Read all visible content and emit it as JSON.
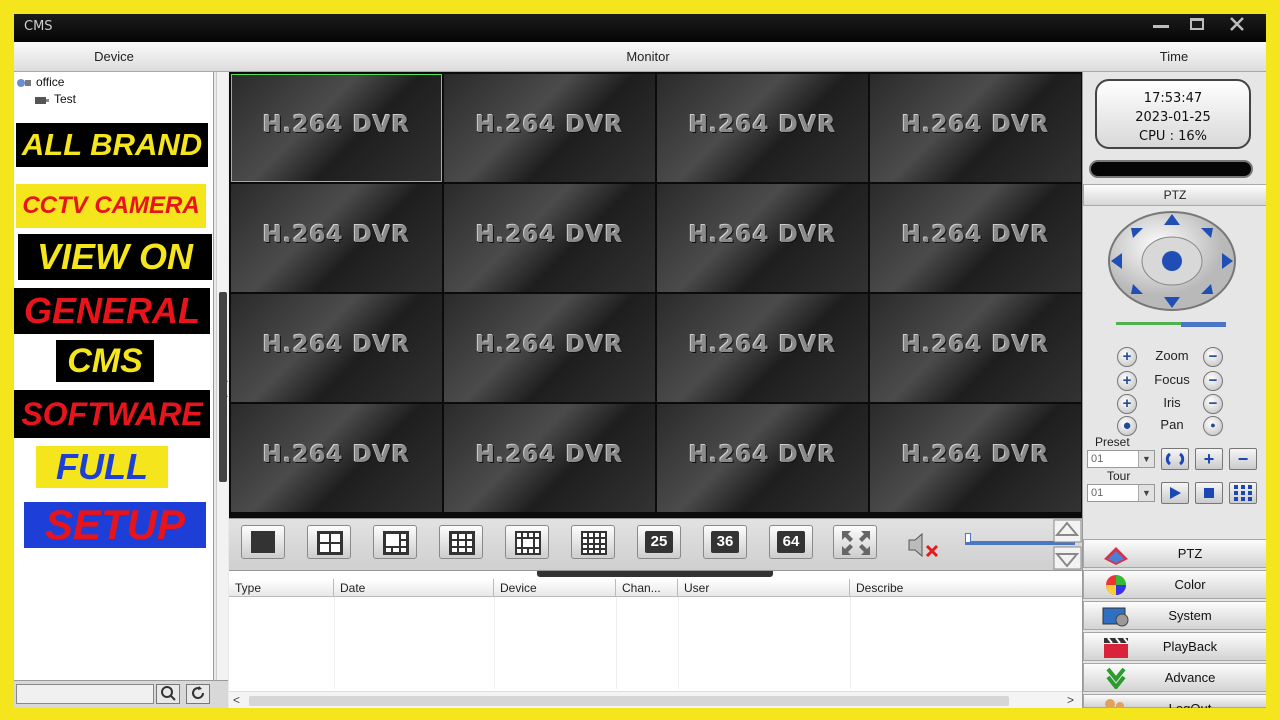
{
  "window": {
    "title": "CMS"
  },
  "columns": {
    "device": "Device",
    "monitor": "Monitor",
    "time": "Time"
  },
  "tree": {
    "root": "office",
    "child": "Test"
  },
  "banners": [
    {
      "text": "ALL BRAND",
      "color": "#f5e51c",
      "bg": "#000000"
    },
    {
      "text": "CCTV CAMERA",
      "color": "#e8141b",
      "bg": "#f5e51c"
    },
    {
      "text": "VIEW ON",
      "color": "#f5e51c",
      "bg": "#000000"
    },
    {
      "text": "GENERAL",
      "color": "#e8141b",
      "bg": "#000000"
    },
    {
      "text": "CMS",
      "color": "#f5e51c",
      "bg": "#000000"
    },
    {
      "text": "SOFTWARE",
      "color": "#e8141b",
      "bg": "#000000"
    },
    {
      "text": "FULL",
      "color": "#1d3fd8",
      "bg": "#f5e51c"
    },
    {
      "text": "SETUP",
      "color": "#e8141b",
      "bg": "#1d3fd8"
    }
  ],
  "grid": {
    "cell_label": "H.264 DVR",
    "rows": 4,
    "cols": 4,
    "selected": 0
  },
  "layouts": [
    "1",
    "4",
    "6",
    "9",
    "13",
    "16",
    "25",
    "36",
    "64"
  ],
  "layout_numbers": {
    "n25": "25",
    "n36": "36",
    "n64": "64"
  },
  "log": {
    "headers": [
      "Type",
      "Date",
      "Device",
      "Chan...",
      "User",
      "Describe"
    ]
  },
  "clock": {
    "time": "17:53:47",
    "date": "2023-01-25",
    "cpu": "CPU : 16%"
  },
  "ptz": {
    "header": "PTZ",
    "zoom": "Zoom",
    "focus": "Focus",
    "iris": "Iris",
    "pan": "Pan",
    "preset_label": "Preset",
    "preset_value": "01",
    "tour_label": "Tour",
    "tour_value": "01"
  },
  "menu": [
    "PTZ",
    "Color",
    "System",
    "PlayBack",
    "Advance",
    "LogOut"
  ],
  "icons": [
    "device-tree-icon",
    "camera-icon",
    "search-icon",
    "refresh-icon",
    "mute-speaker-icon",
    "fullscreen-icon"
  ]
}
